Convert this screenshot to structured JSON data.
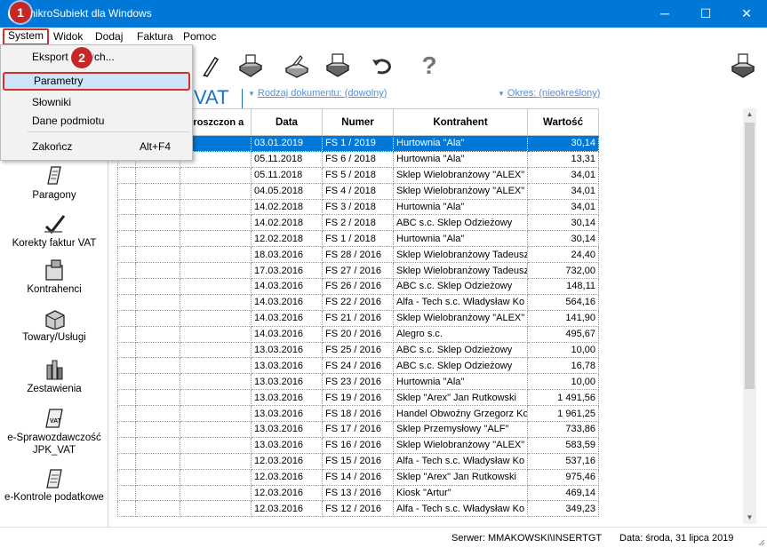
{
  "window": {
    "title": "mikroSubiekt dla Windows",
    "minimize_glyph": "─",
    "maximize_glyph": "☐",
    "close_glyph": "✕"
  },
  "menubar": {
    "items": [
      "System",
      "Widok",
      "Dodaj",
      "Faktura",
      "Pomoc"
    ]
  },
  "dropdown": {
    "export": "Eksport danych...",
    "parametry": "Parametry",
    "slowniki": "Słowniki",
    "dane_podmiotu": "Dane podmiotu",
    "zakoncz": "Zakończ",
    "zakoncz_shortcut": "Alt+F4"
  },
  "callouts": [
    "1",
    "2"
  ],
  "toolbar": {
    "icons": [
      "pen-icon",
      "printer-icon",
      "export-icon",
      "print-icon",
      "refresh-icon",
      "help-icon",
      "printer-setup-icon"
    ],
    "help_glyph": "?"
  },
  "sidebar": {
    "items": [
      "Paragony",
      "Korekty faktur VAT",
      "Kontrahenci",
      "Towary/Usługi",
      "Zestawienia",
      "e-Sprawozdawczość JPK_VAT",
      "e-Kontrole podatkowe"
    ]
  },
  "header": {
    "title_fragment": "VAT",
    "doc_filter": "Rodzaj dokumentu: (dowolny)",
    "period_filter": "Okres: (nieokreślony)",
    "arrow_glyph": "▼"
  },
  "table": {
    "columns": [
      "",
      "",
      "proszczon a",
      "Data",
      "Numer",
      "Kontrahent",
      "Wartość"
    ],
    "rows": [
      [
        "03.01.2019",
        "FS 1 / 2019",
        "Hurtownia \"Ala\"",
        "30,14"
      ],
      [
        "05.11.2018",
        "FS 6 / 2018",
        "Hurtownia \"Ala\"",
        "13,31"
      ],
      [
        "05.11.2018",
        "FS 5 / 2018",
        "Sklep Wielobranżowy \"ALEX\"",
        "34,01"
      ],
      [
        "04.05.2018",
        "FS 4 / 2018",
        "Sklep Wielobranżowy \"ALEX\"",
        "34,01"
      ],
      [
        "14.02.2018",
        "FS 3 / 2018",
        "Hurtownia \"Ala\"",
        "34,01"
      ],
      [
        "14.02.2018",
        "FS 2 / 2018",
        "ABC s.c. Sklep Odzieżowy",
        "30,14"
      ],
      [
        "12.02.2018",
        "FS 1 / 2018",
        "Hurtownia \"Ala\"",
        "30,14"
      ],
      [
        "18.03.2016",
        "FS 28 / 2016",
        "Sklep Wielobranżowy Tadeusz",
        "24,40"
      ],
      [
        "17.03.2016",
        "FS 27 / 2016",
        "Sklep Wielobranżowy Tadeusz",
        "732,00"
      ],
      [
        "14.03.2016",
        "FS 26 / 2016",
        "ABC s.c. Sklep Odzieżowy",
        "148,11"
      ],
      [
        "14.03.2016",
        "FS 22 / 2016",
        "Alfa - Tech s.c. Władysław Ko",
        "564,16"
      ],
      [
        "14.03.2016",
        "FS 21 / 2016",
        "Sklep Wielobranżowy \"ALEX\"",
        "141,90"
      ],
      [
        "14.03.2016",
        "FS 20 / 2016",
        "Alegro s.c.",
        "495,67"
      ],
      [
        "13.03.2016",
        "FS 25 / 2016",
        "ABC s.c. Sklep Odzieżowy",
        "10,00"
      ],
      [
        "13.03.2016",
        "FS 24 / 2016",
        "ABC s.c. Sklep Odzieżowy",
        "16,78"
      ],
      [
        "13.03.2016",
        "FS 23 / 2016",
        "Hurtownia \"Ala\"",
        "10,00"
      ],
      [
        "13.03.2016",
        "FS 19 / 2016",
        "Sklep \"Arex\" Jan Rutkowski",
        "1 491,56"
      ],
      [
        "13.03.2016",
        "FS 18 / 2016",
        "Handel Obwoźny Grzegorz Ko",
        "1 961,25"
      ],
      [
        "13.03.2016",
        "FS 17 / 2016",
        "Sklep Przemysłowy \"ALF\"",
        "733,86"
      ],
      [
        "13.03.2016",
        "FS 16 / 2016",
        "Sklep Wielobranżowy \"ALEX\"",
        "583,59"
      ],
      [
        "12.03.2016",
        "FS 15 / 2016",
        "Alfa - Tech s.c. Władysław Ko",
        "537,16"
      ],
      [
        "12.03.2016",
        "FS 14 / 2016",
        "Sklep \"Arex\" Jan Rutkowski",
        "975,46"
      ],
      [
        "12.03.2016",
        "FS 13 / 2016",
        "Kiosk \"Artur\"",
        "469,14"
      ],
      [
        "12.03.2016",
        "FS 12 / 2016",
        "Alfa - Tech s.c. Władysław Ko",
        "349,23"
      ]
    ],
    "selected_row": 0
  },
  "status": {
    "server": "Serwer: MMAKOWSKI\\INSERTGT",
    "date": "Data: środa, 31 lipca 2019"
  },
  "colors": {
    "titlebar": "#0078d7",
    "selection": "#0078d7",
    "callout": "#c62828",
    "highlight_border": "#d32f2f"
  }
}
